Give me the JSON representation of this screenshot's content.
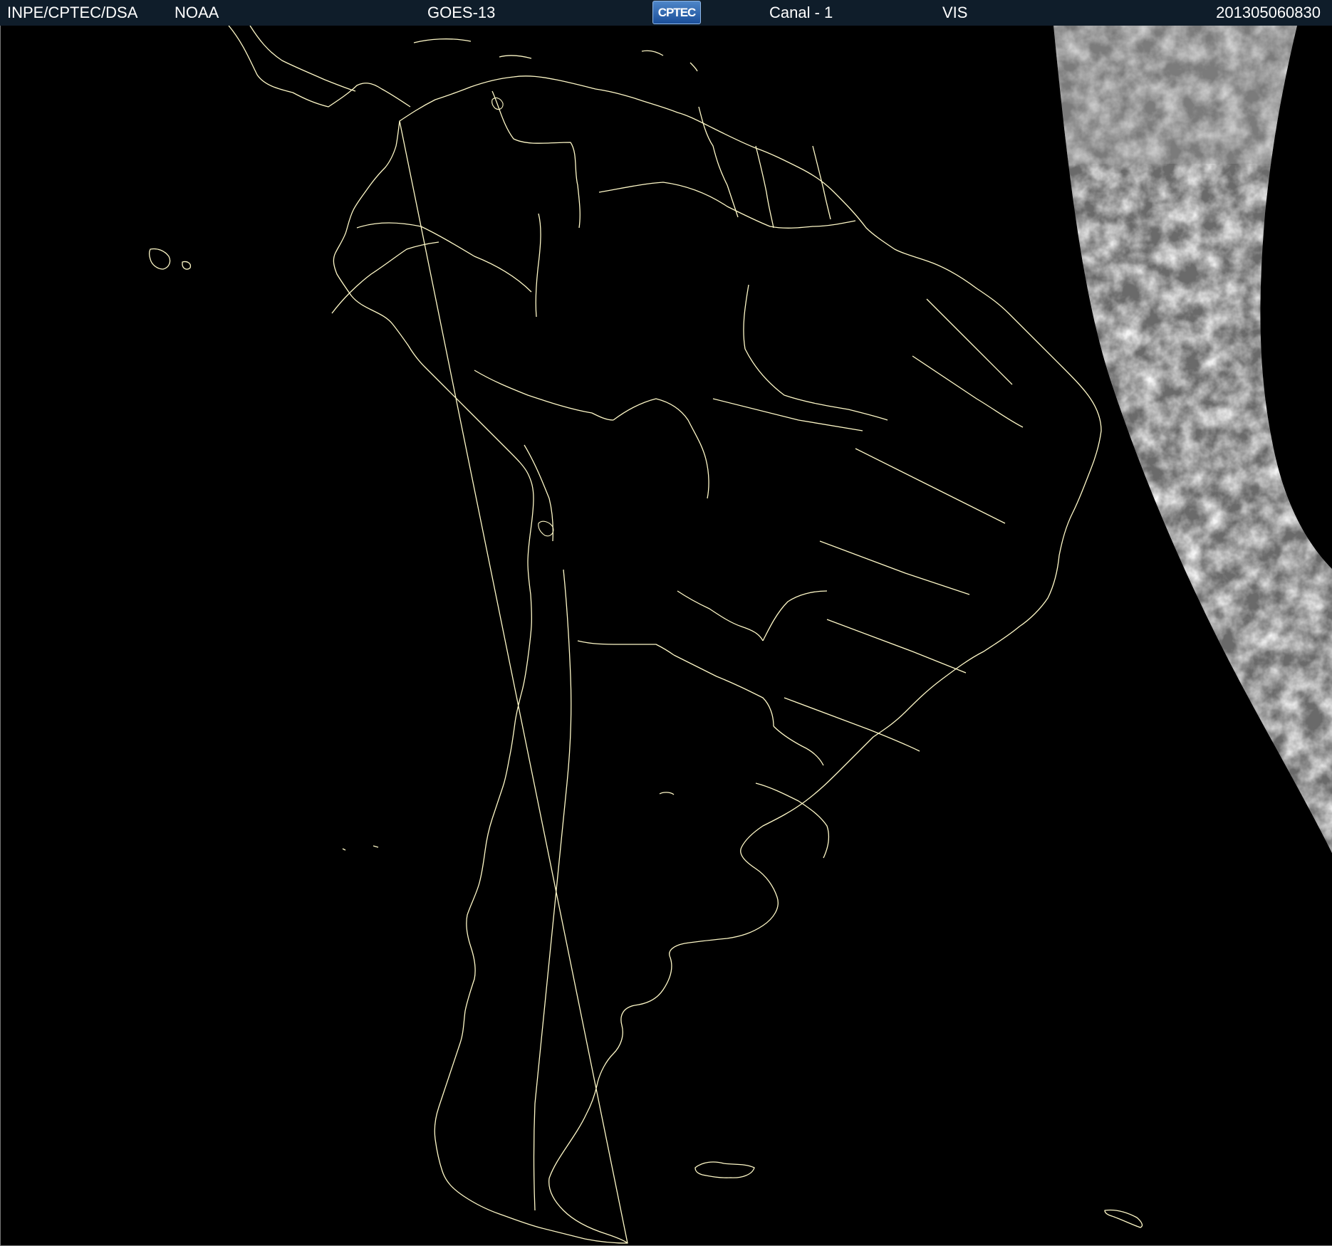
{
  "header": {
    "agency": "INPE/CPTEC/DSA",
    "source": "NOAA",
    "satellite": "GOES-13",
    "logo_text": "CPTEC",
    "channel": "Canal - 1",
    "band": "VIS",
    "timestamp": "201305060830"
  },
  "map": {
    "region": "South America",
    "background_color": "#000000",
    "border_color": "#fff9c8",
    "cloud_color": "#bdbdbd",
    "icons": [
      "cptec-logo-icon"
    ]
  }
}
